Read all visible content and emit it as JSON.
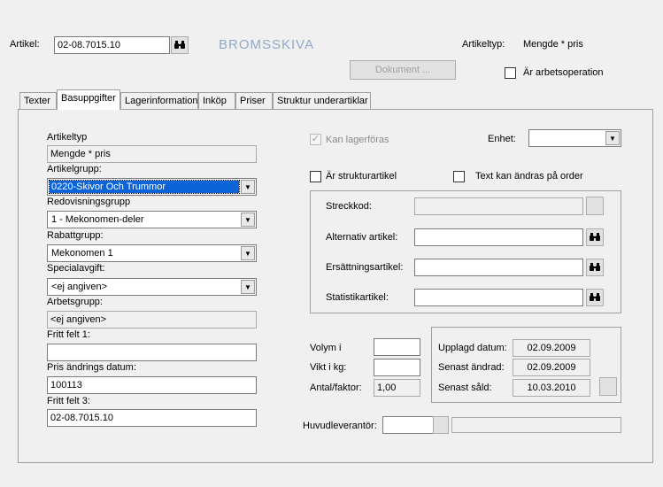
{
  "header": {
    "artikel_label": "Artikel:",
    "artikel_value": "02-08.7015.10",
    "product_title": "BROMSSKIVA",
    "artikeltyp_label": "Artikeltyp:",
    "artikeltyp_value": "Mengde * pris",
    "dokument_label": "Dokument ...",
    "arbetsoperation_label": "Är arbetsoperation"
  },
  "tabs": [
    {
      "label": "Texter"
    },
    {
      "label": "Basuppgifter",
      "active": true
    },
    {
      "label": "Lagerinformation"
    },
    {
      "label": "Inköp"
    },
    {
      "label": "Priser"
    },
    {
      "label": "Struktur underartiklar"
    }
  ],
  "left": {
    "artikeltyp_label": "Artikeltyp",
    "artikeltyp_value": "Mengde * pris",
    "artikelgrupp_label": "Artikelgrupp:",
    "artikelgrupp_value": "0220-Skivor Och Trummor",
    "redovisningsgrupp_label": "Redovisningsgrupp",
    "redovisningsgrupp_value": "1 - Mekonomen-deler",
    "rabattgrupp_label": "Rabattgrupp:",
    "rabattgrupp_value": "Mekonomen 1",
    "specialavgift_label": "Specialavgift:",
    "specialavgift_value": "<ej angiven>",
    "arbetsgrupp_label": "Arbetsgrupp:",
    "arbetsgrupp_value": "<ej angiven>",
    "fritt_felt1_label": "Fritt felt 1:",
    "fritt_felt1_value": "",
    "pris_andrings_label": "Pris ändrings datum:",
    "pris_andrings_value": "100113",
    "fritt_felt3_label": "Fritt felt 3:",
    "fritt_felt3_value": "02-08.7015.10"
  },
  "right": {
    "kan_lagerforas_label": "Kan lagerföras",
    "enhet_label": "Enhet:",
    "enhet_value": "",
    "strukturartikel_label": "Är strukturartikel",
    "text_kan_andras_label": "Text kan ändras på order",
    "streckkod_label": "Streckkod:",
    "streckkod_value": "",
    "alternativ_label": "Alternativ artikel:",
    "alternativ_value": "",
    "ersattning_label": "Ersättningsartikel:",
    "ersattning_value": "",
    "statistik_label": "Statistikartikel:",
    "statistik_value": "",
    "volym_label": "Volym i",
    "volym_value": "",
    "vikt_label": "Vikt i kg:",
    "vikt_value": "",
    "antal_label": "Antal/faktor:",
    "antal_value": "1,00",
    "upplagd_label": "Upplagd datum:",
    "upplagd_value": "02.09.2009",
    "senast_andrad_label": "Senast ändrad:",
    "senast_andrad_value": "02.09.2009",
    "senast_sald_label": "Senast såld:",
    "senast_sald_value": "10.03.2010",
    "huvudleverantor_label": "Huvudleverantör:",
    "huvudleverantor_value": "",
    "huvudleverantor_name": ""
  },
  "icons": {
    "search": "binoculars-icon",
    "dropdown": "chevron-down-icon",
    "check": "checkmark-icon"
  },
  "colors": {
    "selection": "#0a64d8",
    "title": "#90a8c8",
    "background": "#f0f0f0"
  }
}
